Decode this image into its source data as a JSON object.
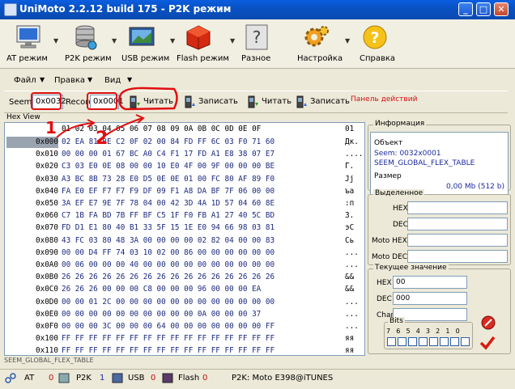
{
  "window": {
    "title": "UniMoto 2.2.12 build 175 - P2K режим",
    "controls": {
      "minimize": "_",
      "maximize": "□",
      "close": "✕"
    }
  },
  "toolbar": {
    "items": [
      {
        "label": "AT режим",
        "icon": "monitor-icon"
      },
      {
        "label": "P2K режим",
        "icon": "database-icon"
      },
      {
        "label": "USB режим",
        "icon": "usb-screen-icon"
      },
      {
        "label": "Flash режим",
        "icon": "red-cube-icon"
      },
      {
        "label": "Разное",
        "icon": "question-card-icon"
      },
      {
        "label": "Настройка",
        "icon": "gears-icon"
      },
      {
        "label": "Справка",
        "icon": "help-circle-icon"
      }
    ]
  },
  "menu": {
    "items": [
      "Файл",
      "Правка",
      "Вид"
    ]
  },
  "actions": {
    "seem_label": "Seem",
    "seem_value": "0x0032",
    "record_label": "Record",
    "record_value": "0x0001",
    "read1": "Читать",
    "write1": "Записать",
    "read2": "Читать",
    "write2": "Записать",
    "panel_label": "Панель действий"
  },
  "hex": {
    "title": "Hex View",
    "header": "01 02 03 04 05 06 07 08 09 0A 0B 0C 0D 0E 0F",
    "header_ascii": "01",
    "rows": [
      {
        "addr": "0x000",
        "bytes": "02 EA 81 BE C2 0F 02 00 84 FD FF 6C 03 F0 71 60",
        "ascii": "Дк."
      },
      {
        "addr": "0x010",
        "bytes": "00 00 00 01 67 BC A0 C4 F1 17 FD A1 E8 38 07 E7",
        "ascii": "...."
      },
      {
        "addr": "0x020",
        "bytes": "C3 03 E0 0E 08 00 00 10 E0 4F 00 9F 00 00 00 BE",
        "ascii": "Г."
      },
      {
        "addr": "0x030",
        "bytes": "A3 BC 8B 73 28 E0 D5 0E 0E 01 00 FC 80 AF 89 F0",
        "ascii": "Jj"
      },
      {
        "addr": "0x040",
        "bytes": "FA E0 EF F7 F7 F9 DF 09 F1 A8 DA BF 7F 06 00 00",
        "ascii": "ъа"
      },
      {
        "addr": "0x050",
        "bytes": "3A EF E7 9E 7F 78 04 00 42 3D 4A 1D 57 04 60 8E",
        "ascii": ":п"
      },
      {
        "addr": "0x060",
        "bytes": "C7 1B FA BD 7B FF BF C5 1F F0 FB A1 27 40 5C BD",
        "ascii": "З."
      },
      {
        "addr": "0x070",
        "bytes": "FD D1 E1 80 40 B1 33 5F 15 1E E0 94 66 98 03 81",
        "ascii": "эС"
      },
      {
        "addr": "0x080",
        "bytes": "43 FC 03 80 48 3A 00 00 00 00 02 82 04 00 00 83",
        "ascii": "Сь"
      },
      {
        "addr": "0x090",
        "bytes": "00 00 D4 FF 74 03 10 02 00 86 00 00 00 00 00 00",
        "ascii": "..."
      },
      {
        "addr": "0x0A0",
        "bytes": "00 06 00 00 00 40 00 00 00 00 00 00 00 00 00 00",
        "ascii": "..."
      },
      {
        "addr": "0x0B0",
        "bytes": "26 26 26 26 26 26 26 26 26 26 26 26 26 26 26 26",
        "ascii": "&&"
      },
      {
        "addr": "0x0C0",
        "bytes": "26 26 26 00 00 00 C8 00 00 00 96 00 00 00 EA",
        "ascii": "&&"
      },
      {
        "addr": "0x0D0",
        "bytes": "00 00 01 2C 00 00 00 00 00 00 00 00 00 00 00 00",
        "ascii": "..."
      },
      {
        "addr": "0x0E0",
        "bytes": "00 00 00 00 00 00 00 00 00 00 0A 00 00 00 37",
        "ascii": "..."
      },
      {
        "addr": "0x0F0",
        "bytes": "00 00 00 3C 00 00 00 64 00 00 00 00 00 00 00 FF",
        "ascii": "..."
      },
      {
        "addr": "0x100",
        "bytes": "FF FF FF FF FF FF FF FF FF FF FF FF FF FF FF FF",
        "ascii": "яя"
      },
      {
        "addr": "0x110",
        "bytes": "FF FF FF FF FF FF FF FF FF FF FF FF FF FF FF FF",
        "ascii": "яя"
      }
    ],
    "status": "SEEM_GLOBAL_FLEX_TABLE"
  },
  "info": {
    "title": "Информация",
    "object_label": "Объект",
    "object_line1": "Seem: 0032x0001",
    "object_line2": "SEEM_GLOBAL_FLEX_TABLE",
    "size_label": "Размер",
    "size_value": "0,00 Mb (512 b)"
  },
  "selected": {
    "title": "Выделенное",
    "hex_label": "HEX",
    "dec_label": "DEC",
    "moto_hex_label": "Moto HEX",
    "moto_dec_label": "Moto DEC"
  },
  "current": {
    "title": "Текущее значение",
    "hex_label": "HEX",
    "hex_value": "00",
    "dec_label": "DEC",
    "dec_value": "000",
    "char_label": "Char",
    "char_value": "",
    "bits_label": "Bits",
    "bit_numbers": "7 6 5 4 3 2 1 0"
  },
  "statusbar": {
    "at_label": "AT",
    "at_value": "0",
    "p2k_label": "P2K",
    "p2k_value": "1",
    "usb_label": "USB",
    "usb_value": "0",
    "flash_label": "Flash",
    "flash_value": "0",
    "device": "P2K: Moto E398@iTUNES"
  },
  "annotations": {
    "num1": "1",
    "num2": "2"
  }
}
